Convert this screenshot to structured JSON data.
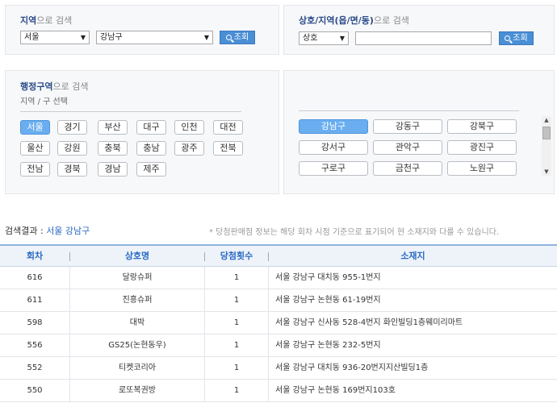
{
  "region_search": {
    "title_bold": "지역",
    "title_rest": "으로 검색",
    "city_select": "서울",
    "district_select": "강남구",
    "search_button": "조회"
  },
  "name_search": {
    "title_bold": "상호/지역(읍/면/동)",
    "title_rest": "으로 검색",
    "type_select": "상호",
    "keyword_value": "",
    "search_button": "조회"
  },
  "admin_search": {
    "title_bold": "행정구역",
    "title_rest": "으로 검색",
    "sub_label": "지역 / 구 선택",
    "regions": [
      "서울",
      "경기",
      "부산",
      "대구",
      "인천",
      "대전",
      "울산",
      "강원",
      "충북",
      "충남",
      "광주",
      "전북",
      "전남",
      "경북",
      "경남",
      "제주"
    ],
    "active_region": "서울",
    "districts": [
      "강남구",
      "강동구",
      "강북구",
      "강서구",
      "관악구",
      "광진구",
      "구로구",
      "금천구",
      "노원구"
    ],
    "active_district": "강남구"
  },
  "scroll_icons": {
    "up": "arrow-up-icon",
    "down": "arrow-down-icon"
  },
  "result": {
    "label": "검색결과 : ",
    "value": "서울 강남구",
    "notice": "* 당첨판매점 정보는 해당 회차 시점 기준으로 표기되어 현 소재지와 다를 수 있습니다."
  },
  "table": {
    "headers": [
      "회차",
      "상호명",
      "당첨횟수",
      "소재지"
    ],
    "rows": [
      {
        "round": "616",
        "name": "달랑슈퍼",
        "count": "1",
        "address": "서울 강남구 대치동 955-1번지"
      },
      {
        "round": "611",
        "name": "진흥슈퍼",
        "count": "1",
        "address": "서울 강남구 논현동 61-19번지"
      },
      {
        "round": "598",
        "name": "대박",
        "count": "1",
        "address": "서울 강남구 신사동 528-4번지 화인빌딩1층웨미리마트"
      },
      {
        "round": "556",
        "name": "GS25(논현동우)",
        "count": "1",
        "address": "서울 강남구 논현동 232-5번지"
      },
      {
        "round": "552",
        "name": "티켓코리아",
        "count": "1",
        "address": "서울 강남구 대치동 936-20번지지산빌딩1층"
      },
      {
        "round": "550",
        "name": "로또복권방",
        "count": "1",
        "address": "서울 강남구 논현동 169번지103호"
      }
    ]
  },
  "colors": {
    "accent": "#2a6bc4",
    "button": "#4a8fd6",
    "active": "#6aaef0"
  }
}
